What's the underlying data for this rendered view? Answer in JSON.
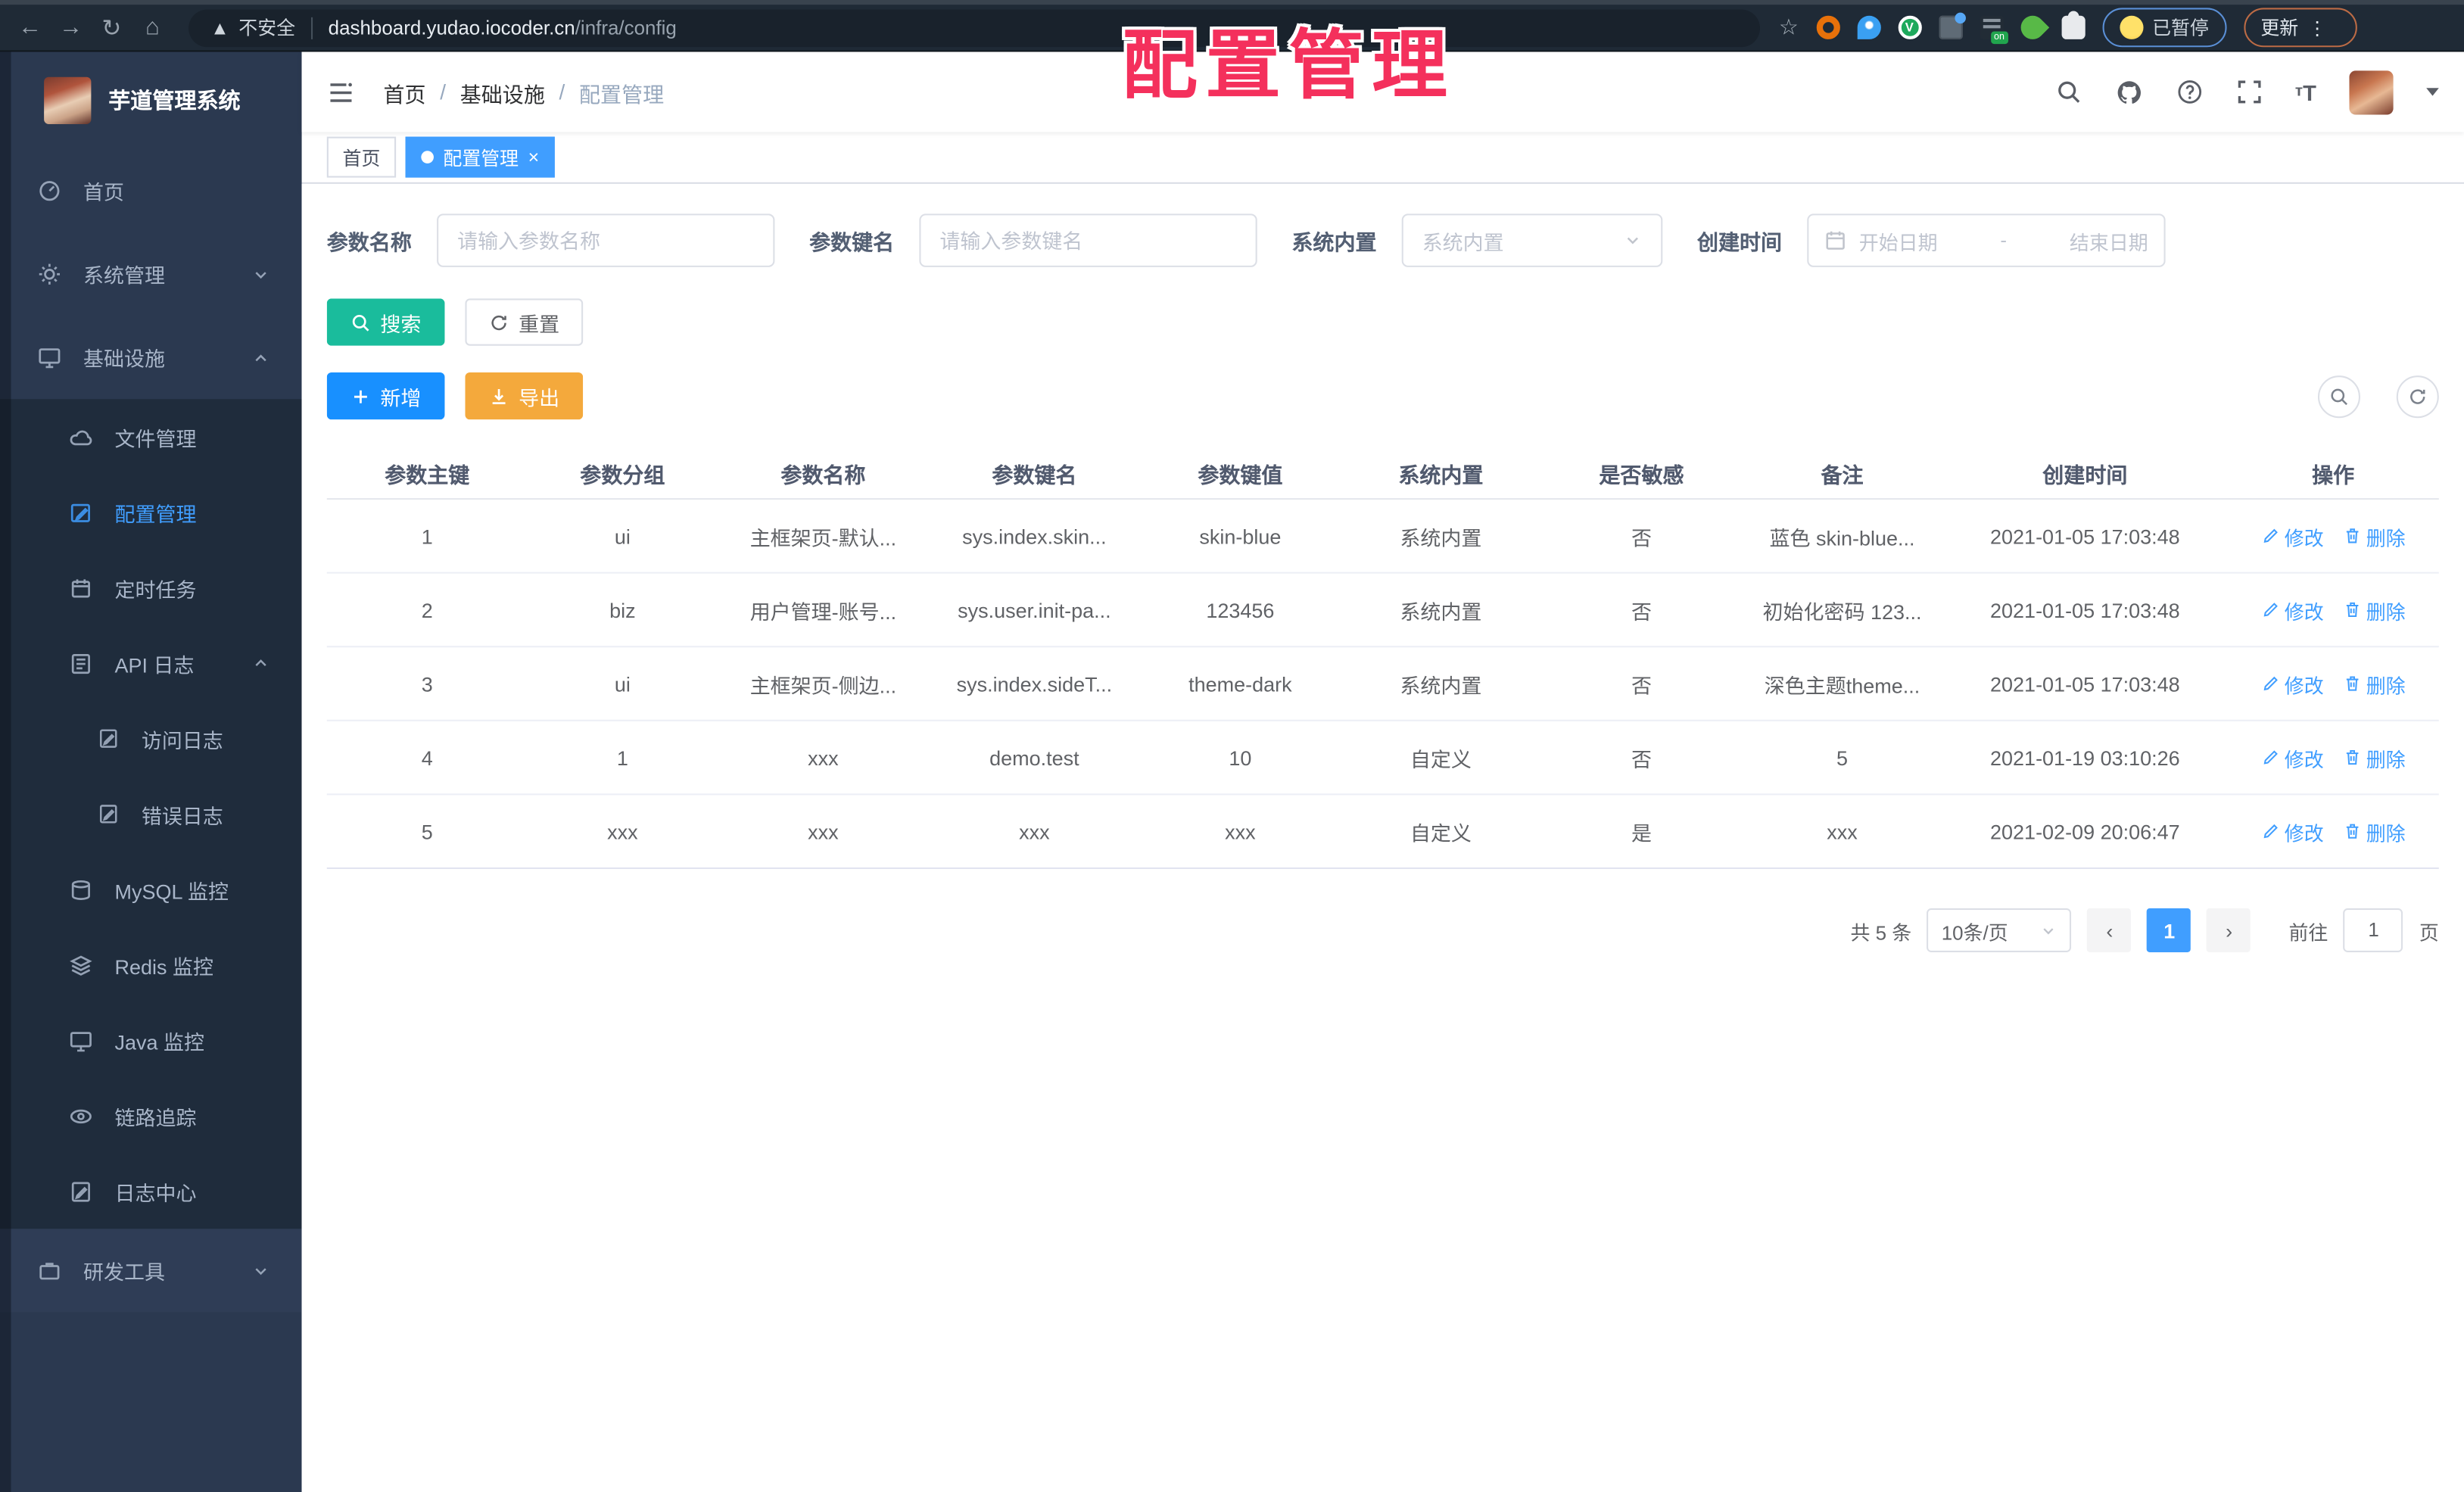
{
  "browser": {
    "security_label": "不安全",
    "url_domain": "dashboard.yudao.iocoder.cn",
    "url_path": "/infra/config",
    "paused_label": "已暂停",
    "update_label": "更新"
  },
  "watermark": "配置管理",
  "sidebar": {
    "title": "芋道管理系统",
    "items": [
      {
        "label": "首页",
        "icon": "gauge-icon"
      },
      {
        "label": "系统管理",
        "icon": "gear-icon",
        "chevron": "down"
      },
      {
        "label": "基础设施",
        "icon": "monitor-icon",
        "chevron": "up",
        "expanded": true
      },
      {
        "label": "文件管理",
        "icon": "cloud-icon",
        "level": 2
      },
      {
        "label": "配置管理",
        "icon": "edit-square-icon",
        "level": 2,
        "active": true
      },
      {
        "label": "定时任务",
        "icon": "schedule-icon",
        "level": 2
      },
      {
        "label": "API 日志",
        "icon": "log-icon",
        "level": 2,
        "chevron": "up",
        "expanded": true
      },
      {
        "label": "访问日志",
        "icon": "log-icon",
        "level": 3
      },
      {
        "label": "错误日志",
        "icon": "log-icon",
        "level": 3
      },
      {
        "label": "MySQL 监控",
        "icon": "database-icon",
        "level": 2
      },
      {
        "label": "Redis 监控",
        "icon": "layers-icon",
        "level": 2
      },
      {
        "label": "Java 监控",
        "icon": "monitor-icon",
        "level": 2
      },
      {
        "label": "链路追踪",
        "icon": "eye-icon",
        "level": 2
      },
      {
        "label": "日志中心",
        "icon": "log-icon",
        "level": 2
      },
      {
        "label": "研发工具",
        "icon": "briefcase-icon",
        "chevron": "down"
      }
    ]
  },
  "header": {
    "breadcrumb": [
      "首页",
      "基础设施",
      "配置管理"
    ],
    "separator": "/"
  },
  "tabs": [
    {
      "label": "首页"
    },
    {
      "label": "配置管理",
      "active": true,
      "close": "×"
    }
  ],
  "filters": [
    {
      "label": "参数名称",
      "placeholder": "请输入参数名称"
    },
    {
      "label": "参数键名",
      "placeholder": "请输入参数键名"
    },
    {
      "label": "系统内置",
      "placeholder": "系统内置"
    },
    {
      "label": "创建时间",
      "start_placeholder": "开始日期",
      "separator": "-",
      "end_placeholder": "结束日期"
    }
  ],
  "toolbar": {
    "search_label": "搜索",
    "reset_label": "重置",
    "add_label": "新增",
    "export_label": "导出"
  },
  "table": {
    "headers": [
      "参数主键",
      "参数分组",
      "参数名称",
      "参数键名",
      "参数键值",
      "系统内置",
      "是否敏感",
      "备注",
      "创建时间",
      "操作"
    ],
    "action_edit": "修改",
    "action_delete": "删除",
    "rows": [
      {
        "cells": [
          "1",
          "ui",
          "主框架页-默认...",
          "sys.index.skin...",
          "skin-blue",
          "系统内置",
          "否",
          "蓝色 skin-blue...",
          "2021-01-05 17:03:48"
        ]
      },
      {
        "cells": [
          "2",
          "biz",
          "用户管理-账号...",
          "sys.user.init-pa...",
          "123456",
          "系统内置",
          "否",
          "初始化密码 123...",
          "2021-01-05 17:03:48"
        ]
      },
      {
        "cells": [
          "3",
          "ui",
          "主框架页-侧边...",
          "sys.index.sideT...",
          "theme-dark",
          "系统内置",
          "否",
          "深色主题theme...",
          "2021-01-05 17:03:48"
        ]
      },
      {
        "cells": [
          "4",
          "1",
          "xxx",
          "demo.test",
          "10",
          "自定义",
          "否",
          "5",
          "2021-01-19 03:10:26"
        ]
      },
      {
        "cells": [
          "5",
          "xxx",
          "xxx",
          "xxx",
          "xxx",
          "自定义",
          "是",
          "xxx",
          "2021-02-09 20:06:47"
        ]
      }
    ]
  },
  "pagination": {
    "total": "共 5 条",
    "page_size": "10条/页",
    "prev": "‹",
    "next": "›",
    "current": "1",
    "goto_label": "前往",
    "goto_value": "1",
    "page_unit": "页"
  },
  "colors": {
    "primary": "#409eff",
    "add_button": "#1890ff",
    "search_button": "#1abc9c",
    "export_button": "#f4a93c",
    "active_tab": "#409eff",
    "action_link": "#409eff",
    "watermark": "#f4305c",
    "sidebar_bg": "#2b3950",
    "sidebar_submenu_bg": "#1f2c3c",
    "sidebar_active_text": "#409eff",
    "browser_bar_bg": "#1f2a36",
    "pager_active_bg": "#409eff"
  }
}
